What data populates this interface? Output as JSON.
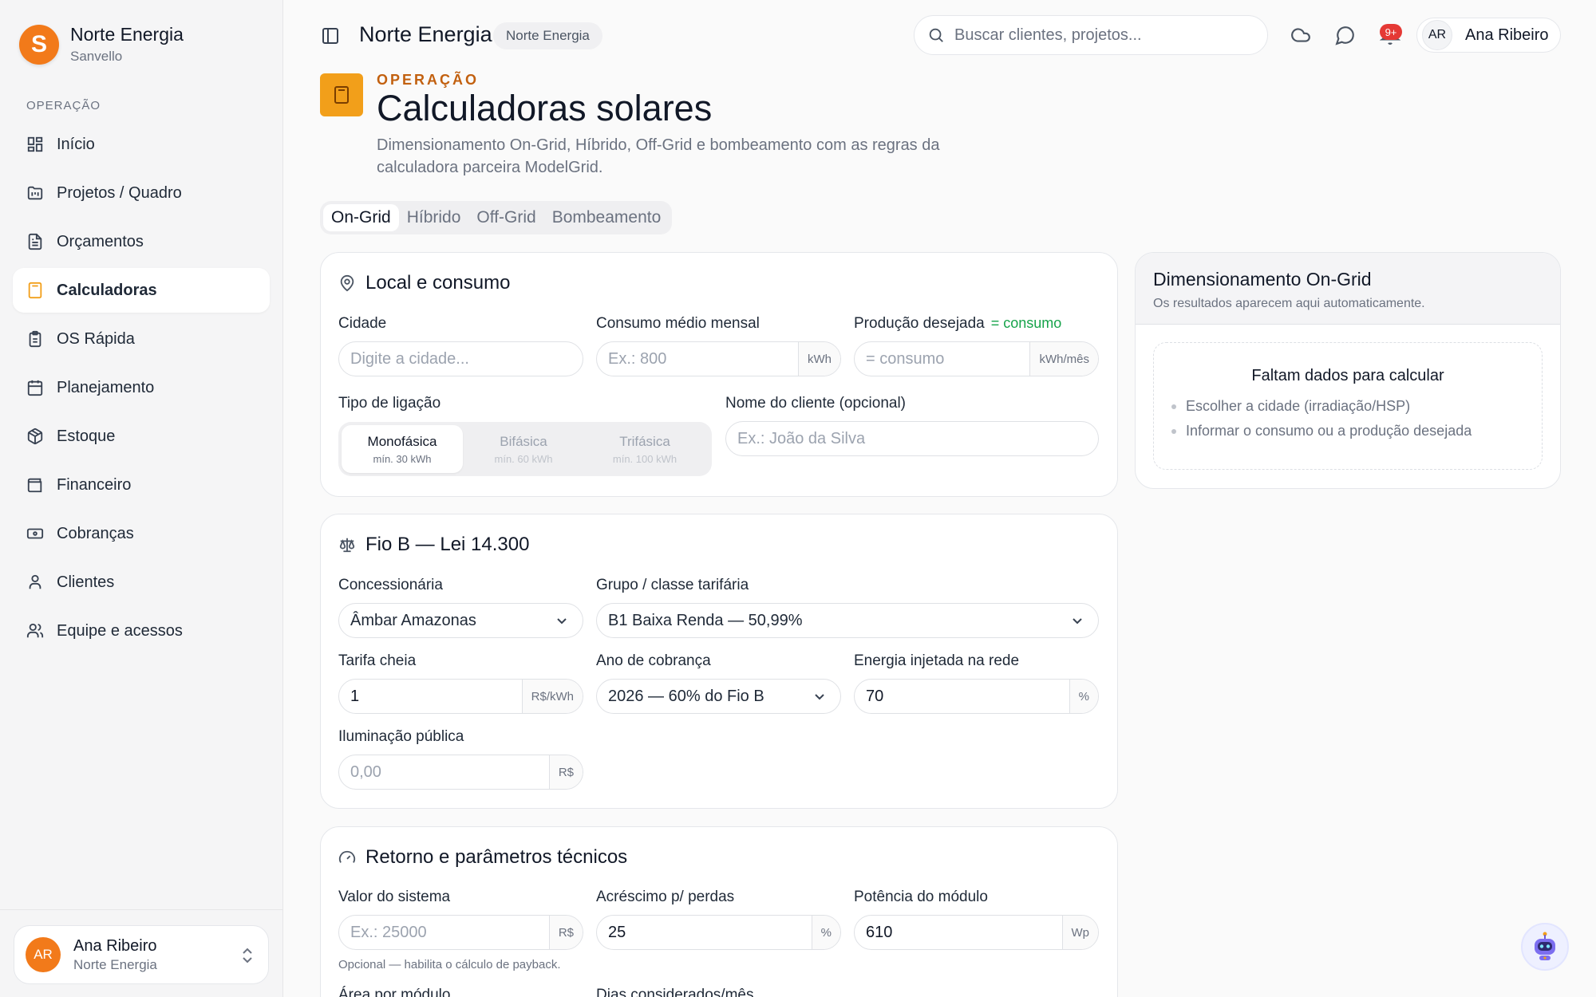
{
  "brand": {
    "initial": "S",
    "name": "Norte Energia",
    "subtitle": "Sanvello"
  },
  "sidebar": {
    "section": "OPERAÇÃO",
    "items": [
      {
        "label": "Início",
        "icon": "grid-icon",
        "active": false
      },
      {
        "label": "Projetos / Quadro",
        "icon": "kanban-icon",
        "active": false
      },
      {
        "label": "Orçamentos",
        "icon": "document-icon",
        "active": false
      },
      {
        "label": "Calculadoras",
        "icon": "calculator-icon",
        "active": true
      },
      {
        "label": "OS Rápida",
        "icon": "clipboard-icon",
        "active": false
      },
      {
        "label": "Planejamento",
        "icon": "calendar-icon",
        "active": false
      },
      {
        "label": "Estoque",
        "icon": "package-icon",
        "active": false
      },
      {
        "label": "Financeiro",
        "icon": "wallet-icon",
        "active": false
      },
      {
        "label": "Cobranças",
        "icon": "banknote-icon",
        "active": false
      },
      {
        "label": "Clientes",
        "icon": "user-icon",
        "active": false
      },
      {
        "label": "Equipe e acessos",
        "icon": "users-icon",
        "active": false
      }
    ],
    "user": {
      "initials": "AR",
      "name": "Ana Ribeiro",
      "org": "Norte Energia"
    }
  },
  "topbar": {
    "title": "Norte Energia",
    "badge": "Norte Energia",
    "search_placeholder": "Buscar clientes, projetos...",
    "notifications": "9+",
    "profile": {
      "initials": "AR",
      "name": "Ana Ribeiro"
    }
  },
  "page": {
    "eyebrow": "OPERAÇÃO",
    "title": "Calculadoras solares",
    "description": "Dimensionamento On-Grid, Híbrido, Off-Grid e bombeamento com as regras da calculadora parceira ModelGrid.",
    "tabs": [
      "On-Grid",
      "Híbrido",
      "Off-Grid",
      "Bombeamento"
    ],
    "active_tab": "On-Grid"
  },
  "local": {
    "title": "Local e consumo",
    "cidade_label": "Cidade",
    "cidade_placeholder": "Digite a cidade...",
    "consumo_label": "Consumo médio mensal",
    "consumo_placeholder": "Ex.: 800",
    "consumo_unit": "kWh",
    "producao_label": "Produção desejada",
    "producao_note": "= consumo",
    "producao_placeholder": "= consumo",
    "producao_unit": "kWh/mês",
    "ligacao_label": "Tipo de ligação",
    "ligacao_options": [
      {
        "label": "Monofásica",
        "sub": "mín. 30 kWh"
      },
      {
        "label": "Bifásica",
        "sub": "mín. 60 kWh"
      },
      {
        "label": "Trifásica",
        "sub": "mín. 100 kWh"
      }
    ],
    "cliente_label": "Nome do cliente (opcional)",
    "cliente_placeholder": "Ex.: João da Silva"
  },
  "fiob": {
    "title": "Fio B — Lei 14.300",
    "concessionaria_label": "Concessionária",
    "concessionaria_value": "Âmbar Amazonas",
    "grupo_label": "Grupo / classe tarifária",
    "grupo_value": "B1 Baixa Renda — 50,99%",
    "tarifa_label": "Tarifa cheia",
    "tarifa_value": "1",
    "tarifa_unit": "R$/kWh",
    "ano_label": "Ano de cobrança",
    "ano_value": "2026 — 60% do Fio B",
    "injetada_label": "Energia injetada na rede",
    "injetada_value": "70",
    "injetada_unit": "%",
    "iluminacao_label": "Iluminação pública",
    "iluminacao_placeholder": "0,00",
    "iluminacao_unit": "R$"
  },
  "retorno": {
    "title": "Retorno e parâmetros técnicos",
    "valor_label": "Valor do sistema",
    "valor_placeholder": "Ex.: 25000",
    "valor_unit": "R$",
    "valor_helper": "Opcional — habilita o cálculo de payback.",
    "perdas_label": "Acréscimo p/ perdas",
    "perdas_value": "25",
    "perdas_unit": "%",
    "potencia_label": "Potência do módulo",
    "potencia_value": "610",
    "potencia_unit": "Wp",
    "area_label": "Área por módulo",
    "dias_label": "Dias considerados/mês"
  },
  "result": {
    "title": "Dimensionamento On-Grid",
    "subtitle": "Os resultados aparecem aqui automaticamente.",
    "missing_title": "Faltam dados para calcular",
    "missing_items": [
      "Escolher a cidade (irradiação/HSP)",
      "Informar o consumo ou a produção desejada"
    ]
  },
  "colors": {
    "accent": "#f27a1a",
    "eyebrow": "#c2600f",
    "note_green": "#16a34a",
    "notification": "#e53935"
  }
}
